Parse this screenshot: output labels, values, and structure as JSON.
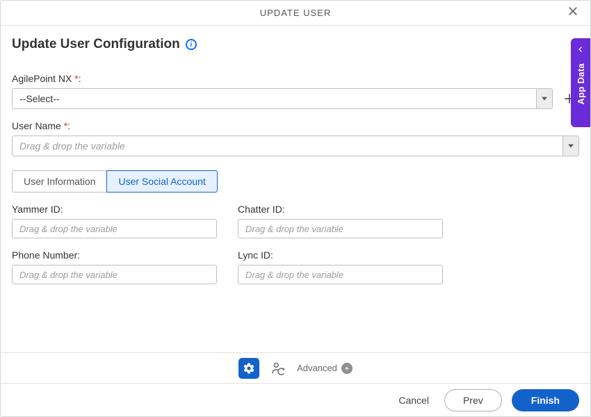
{
  "modal": {
    "title": "UPDATE USER"
  },
  "page": {
    "title": "Update User Configuration"
  },
  "fields": {
    "agilepoint": {
      "label": "AgilePoint NX",
      "required_mark": "*",
      "colon": ":",
      "value": "--Select--"
    },
    "username": {
      "label": "User Name",
      "required_mark": "*",
      "colon": ":",
      "placeholder": "Drag & drop the variable"
    }
  },
  "tabs": {
    "user_info": "User Information",
    "user_social": "User Social Account"
  },
  "social": {
    "yammer": {
      "label": "Yammer ID:",
      "placeholder": "Drag & drop the variable"
    },
    "chatter": {
      "label": "Chatter ID:",
      "placeholder": "Drag & drop the variable"
    },
    "phone": {
      "label": "Phone Number:",
      "placeholder": "Drag & drop the variable"
    },
    "lync": {
      "label": "Lync ID:",
      "placeholder": "Drag & drop the variable"
    }
  },
  "toolbar": {
    "advanced": "Advanced"
  },
  "footer": {
    "cancel": "Cancel",
    "prev": "Prev",
    "finish": "Finish"
  },
  "side": {
    "label": "App Data"
  }
}
